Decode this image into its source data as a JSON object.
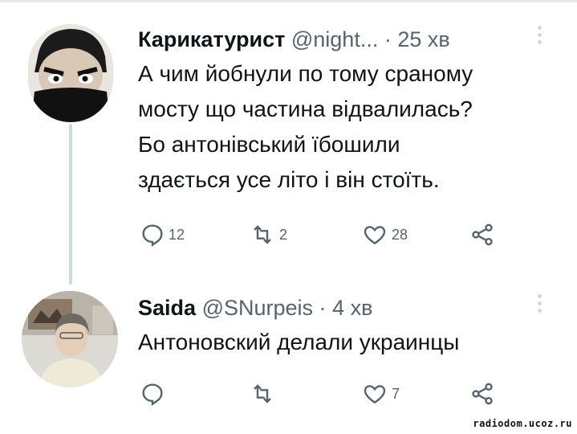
{
  "tweets": [
    {
      "name": "Карикатурист",
      "handle": "@night...",
      "dot": "·",
      "time": "25 хв",
      "text": "А чим йобнули по тому сраному\nмосту що частина відвалилась?\nБо антонівський їбошили\nздається усе літо і він стоїть.",
      "replies": "12",
      "retweets": "2",
      "likes": "28"
    },
    {
      "name": "Saida",
      "handle": "@SNurpeis",
      "dot": "·",
      "time": "4 хв",
      "text": "Антоновский делали украинцы",
      "replies": "",
      "retweets": "",
      "likes": "7"
    }
  ],
  "icons": {
    "reply": "reply-icon",
    "retweet": "retweet-icon",
    "like": "like-icon",
    "share": "share-icon",
    "more": "more-icon"
  },
  "colors": {
    "text": "#0f1419",
    "secondary": "#536471",
    "thread_line": "#cfd9de"
  },
  "watermark": "radiodom.ucoz.ru"
}
